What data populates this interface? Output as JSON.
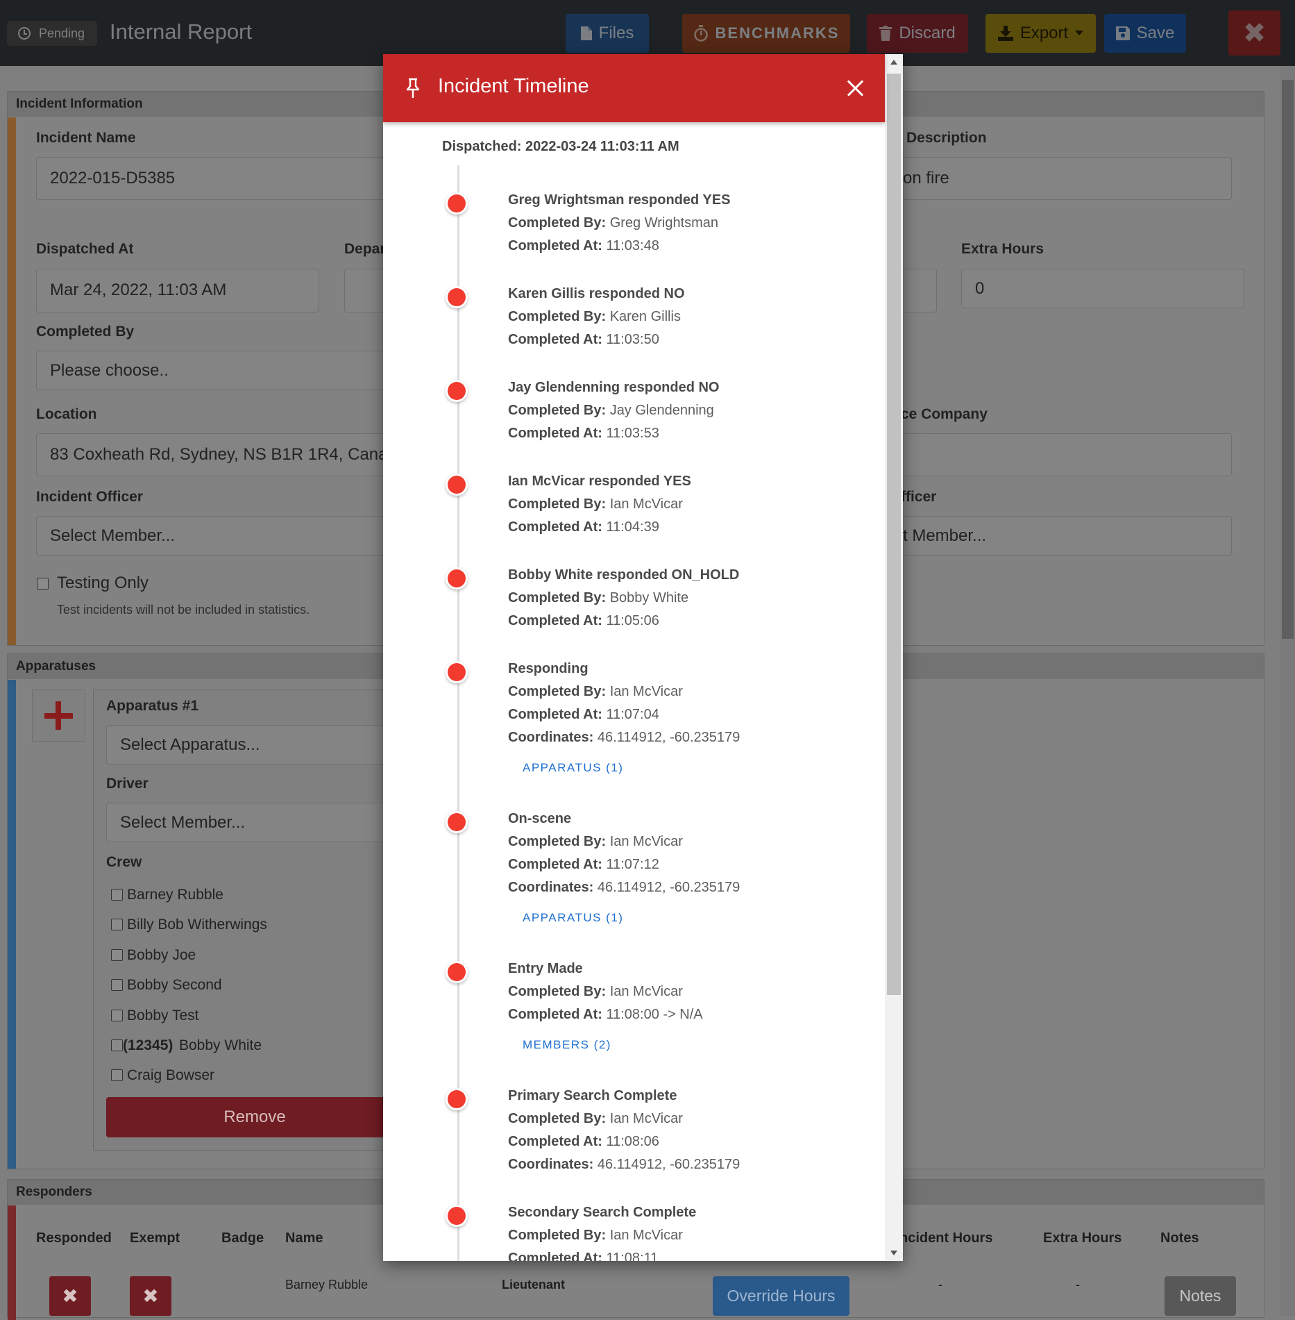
{
  "header": {
    "status": "Pending",
    "title": "Internal Report",
    "files_label": "Files",
    "benchmarks_label": "BENCHMARKS",
    "discard_label": "Discard",
    "export_label": "Export",
    "save_label": "Save",
    "close_label": "✖"
  },
  "incident_info": {
    "section_title": "Incident Information",
    "incident_name_label": "Incident Name",
    "incident_name_value": "2022-015-D5385",
    "description_label": "Description",
    "description_value": "on fire",
    "dispatched_at_label": "Dispatched At",
    "dispatched_at_value": "Mar 24, 2022, 11:03 AM",
    "departed_label": "Depar",
    "extra_hours_label": "Extra Hours",
    "extra_hours_value": "0",
    "completed_by_label": "Completed By",
    "completed_by_value": "Please choose..",
    "location_label": "Location",
    "location_value": "83 Coxheath Rd, Sydney, NS B1R 1R4, Canada",
    "company_label": "ce Company",
    "incident_officer_label": "Incident Officer",
    "incident_officer_value": "Select Member...",
    "officer_label": "fficer",
    "officer_value": "t Member...",
    "testing_only_label": "Testing Only",
    "testing_only_help": "Test incidents will not be included in statistics."
  },
  "apparatuses": {
    "section_title": "Apparatuses",
    "apparatus_label": "Apparatus #1",
    "apparatus_value": "Select Apparatus...",
    "driver_label": "Driver",
    "driver_value": "Select Member...",
    "crew_label": "Crew",
    "crew": [
      {
        "name": "Barney Rubble",
        "badge": ""
      },
      {
        "name": "Billy Bob Witherwings",
        "badge": ""
      },
      {
        "name": "Bobby Joe",
        "badge": ""
      },
      {
        "name": "Bobby Second",
        "badge": ""
      },
      {
        "name": "Bobby Test",
        "badge": ""
      },
      {
        "name": "Bobby White",
        "badge": "(12345)"
      },
      {
        "name": "Craig Bowser",
        "badge": ""
      }
    ],
    "remove_label": "Remove"
  },
  "responders": {
    "section_title": "Responders",
    "columns": [
      "Responded",
      "Exempt",
      "Badge",
      "Name",
      "ncident Hours",
      "Extra Hours",
      "Notes"
    ],
    "row": {
      "responded": "✖",
      "exempt": "✖",
      "name": "Barney Rubble",
      "rank": "Lieutenant",
      "override_label": "Override Hours",
      "incident_hours": "-",
      "extra_hours": "-",
      "notes_label": "Notes"
    }
  },
  "timeline": {
    "title": "Incident Timeline",
    "dispatched": "Dispatched: 2022-03-24 11:03:11 AM",
    "completed_by_label": "Completed By:",
    "completed_at_label": "Completed At:",
    "coordinates_label": "Coordinates:",
    "events": [
      {
        "title": "Greg Wrightsman responded YES",
        "by": "Greg Wrightsman",
        "at": "11:03:48"
      },
      {
        "title": "Karen Gillis responded NO",
        "by": "Karen Gillis",
        "at": "11:03:50"
      },
      {
        "title": "Jay Glendenning responded NO",
        "by": "Jay Glendenning",
        "at": "11:03:53"
      },
      {
        "title": "Ian McVicar responded YES",
        "by": "Ian McVicar",
        "at": "11:04:39"
      },
      {
        "title": "Bobby White responded ON_HOLD",
        "by": "Bobby White",
        "at": "11:05:06"
      },
      {
        "title": "Responding",
        "by": "Ian McVicar",
        "at": "11:07:04",
        "coords": "46.114912, -60.235179",
        "link": "APPARATUS (1)"
      },
      {
        "title": "On-scene",
        "by": "Ian McVicar",
        "at": "11:07:12",
        "coords": "46.114912, -60.235179",
        "link": "APPARATUS (1)"
      },
      {
        "title": "Entry Made",
        "by": "Ian McVicar",
        "at": "11:08:00 -> N/A",
        "link": "MEMBERS (2)"
      },
      {
        "title": "Primary Search Complete",
        "by": "Ian McVicar",
        "at": "11:08:06",
        "coords": "46.114912, -60.235179"
      },
      {
        "title": "Secondary Search Complete",
        "by": "Ian McVicar",
        "at": "11:08:11"
      }
    ]
  }
}
